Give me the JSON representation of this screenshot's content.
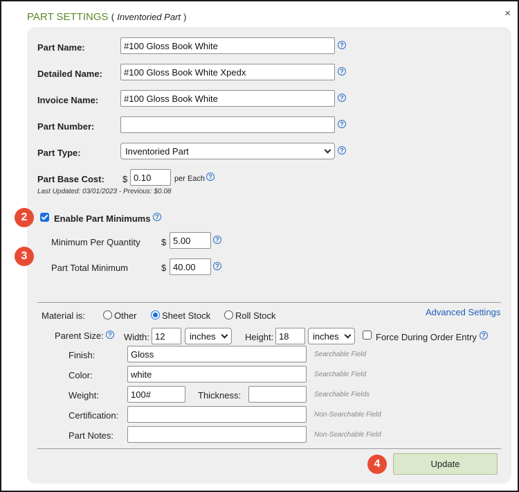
{
  "dialog": {
    "title": "PART SETTINGS",
    "paren_open": "(",
    "subtitle": "Inventoried Part",
    "paren_close": ")",
    "close_glyph": "×"
  },
  "fields": {
    "part_name": {
      "label": "Part Name:",
      "value": "#100 Gloss Book White"
    },
    "detailed_name": {
      "label": "Detailed Name:",
      "value": "#100 Gloss Book White Xpedx"
    },
    "invoice_name": {
      "label": "Invoice Name:",
      "value": "#100 Gloss Book White"
    },
    "part_number": {
      "label": "Part Number:",
      "value": ""
    },
    "part_type": {
      "label": "Part Type:",
      "value": "Inventoried Part"
    },
    "base_cost": {
      "label": "Part Base Cost:",
      "currency": "$",
      "value": "0.10",
      "unit": "per Each",
      "note": "Last Updated: 03/01/2023 - Previous: $0.08"
    }
  },
  "minimums": {
    "checkbox_label": "Enable Part Minimums",
    "checked": true,
    "per_quantity": {
      "label": "Minimum Per Quantity",
      "currency": "$",
      "value": "5.00"
    },
    "total": {
      "label": "Part Total Minimum",
      "currency": "$",
      "value": "40.00"
    }
  },
  "material": {
    "label": "Material is:",
    "options": [
      "Other",
      "Sheet Stock",
      "Roll Stock"
    ],
    "selected": "Sheet Stock",
    "advanced_link": "Advanced Settings",
    "parent_size": {
      "label": "Parent Size:",
      "width_label": "Width:",
      "width_value": "12",
      "width_unit": "inches",
      "height_label": "Height:",
      "height_value": "18",
      "height_unit": "inches",
      "force_label": "Force During Order Entry",
      "force_checked": false
    },
    "finish": {
      "label": "Finish:",
      "value": "Gloss",
      "note": "Searchable Field"
    },
    "color": {
      "label": "Color:",
      "value": "white",
      "note": "Searchable Field"
    },
    "weight": {
      "label": "Weight:",
      "value": "100#",
      "thickness_label": "Thickness:",
      "thickness_value": "",
      "note": "Searchable Fields"
    },
    "certification": {
      "label": "Certification:",
      "value": "",
      "note": "Non-Searchable Field"
    },
    "part_notes": {
      "label": "Part Notes:",
      "value": "",
      "note": "Non-Searchable Field"
    }
  },
  "footer": {
    "update_label": "Update"
  },
  "badges": {
    "b2": "2",
    "b3": "3",
    "b4": "4"
  },
  "colors": {
    "title_green": "#5a8a2c",
    "badge_red": "#e84b33",
    "link_blue": "#1f5fb8",
    "update_bg": "#dbe8cc"
  }
}
